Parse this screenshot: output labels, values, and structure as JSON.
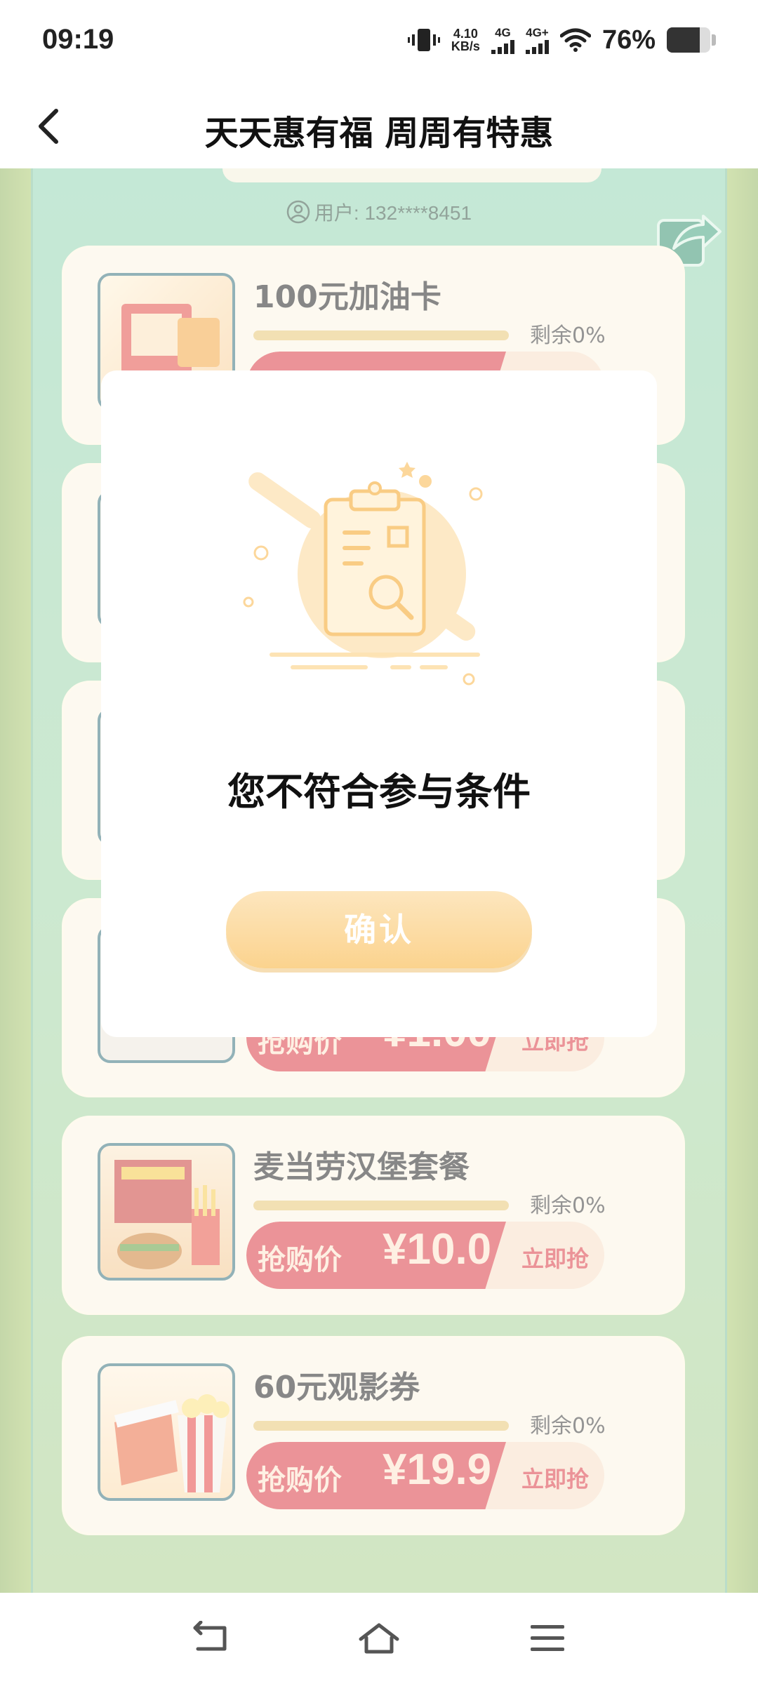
{
  "status_bar": {
    "time": "09:19",
    "net_speed_value": "4.10",
    "net_speed_unit": "KB/s",
    "sim1_label": "4G",
    "sim2_label": "4G+",
    "battery_pct": "76%",
    "battery_level": 0.76
  },
  "header": {
    "title": "天天惠有福 周周有特惠"
  },
  "page": {
    "user_label": "用户: 132****8451",
    "remain_label": "剩余0%",
    "price_label": "抢购价",
    "grab_label": "立即抢",
    "products": [
      {
        "title": "100元加油卡",
        "price": "",
        "remain": "剩余0%"
      },
      {
        "title": "",
        "price": "",
        "remain": ""
      },
      {
        "title": "",
        "price": "",
        "remain": ""
      },
      {
        "title": "",
        "price": "¥1.00",
        "remain": ""
      },
      {
        "title": "麦当劳汉堡套餐",
        "price": "¥10.0",
        "remain": "剩余0%"
      },
      {
        "title": "60元观影券",
        "price": "¥19.9",
        "remain": "剩余0%"
      }
    ]
  },
  "modal": {
    "message": "您不符合参与条件",
    "confirm_label": "确认"
  },
  "colors": {
    "accent_red": "#d9313a",
    "button_orange": "#fbd38e",
    "page_green": "#8fd3b0"
  }
}
